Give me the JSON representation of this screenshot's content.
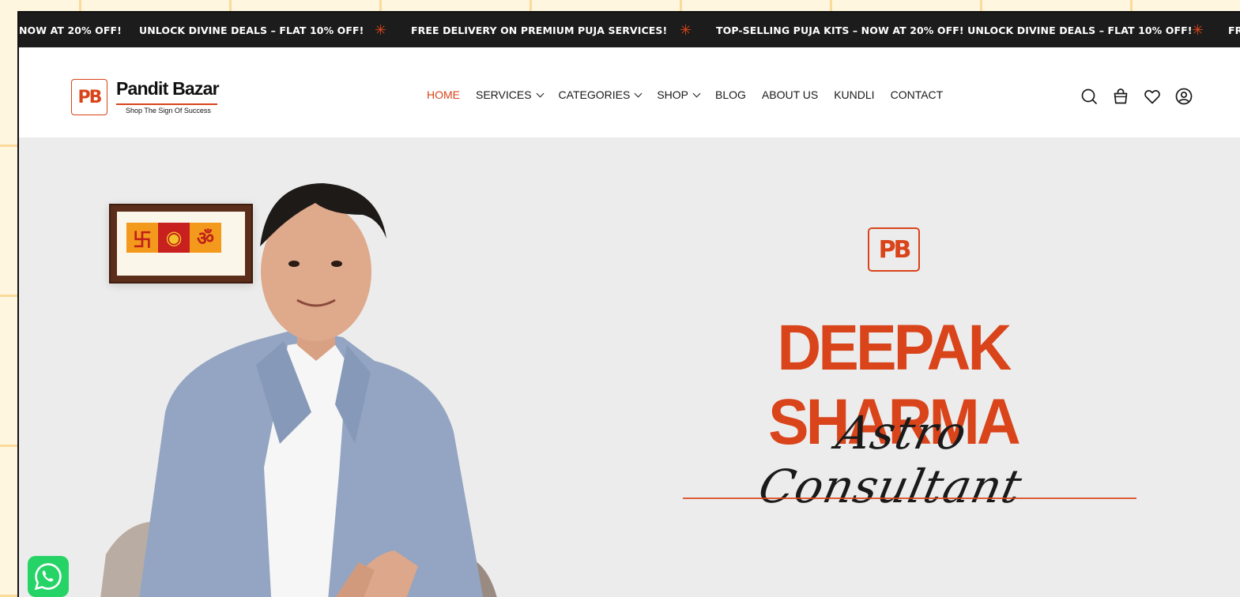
{
  "announcement_bar": {
    "segments": [
      "NOW AT 20% OFF!",
      "UNLOCK DIVINE DEALS – FLAT 10% OFF!",
      "FREE DELIVERY ON PREMIUM PUJA SERVICES!",
      "TOP-SELLING PUJA KITS – NOW AT 20% OFF! UNLOCK DIVINE DEALS – FLAT 10% OFF!",
      "FR"
    ],
    "separator_icon": "sparkle-icon"
  },
  "header": {
    "logo": {
      "mark": "PB",
      "name": "Pandit Bazar",
      "tagline": "Shop The Sign Of Success"
    },
    "nav": [
      {
        "label": "HOME",
        "active": true,
        "dropdown": false
      },
      {
        "label": "SERVICES",
        "active": false,
        "dropdown": true
      },
      {
        "label": "CATEGORIES",
        "active": false,
        "dropdown": true
      },
      {
        "label": "SHOP",
        "active": false,
        "dropdown": true
      },
      {
        "label": "BLOG",
        "active": false,
        "dropdown": false
      },
      {
        "label": "ABOUT US",
        "active": false,
        "dropdown": false
      },
      {
        "label": "KUNDLI",
        "active": false,
        "dropdown": false
      },
      {
        "label": "CONTACT",
        "active": false,
        "dropdown": false
      }
    ],
    "icons": [
      "search-icon",
      "cart-bag-icon",
      "wishlist-heart-icon",
      "account-icon"
    ]
  },
  "hero": {
    "brand_mark": "PB",
    "name": "DEEPAK SHARMA",
    "role": "Astro Consultant"
  },
  "floating": {
    "whatsapp_icon": "whatsapp-icon"
  },
  "colors": {
    "accent": "#d9441a",
    "ticker_bg": "#1c1c1c",
    "hero_bg": "#ececec",
    "whatsapp": "#25d366"
  }
}
